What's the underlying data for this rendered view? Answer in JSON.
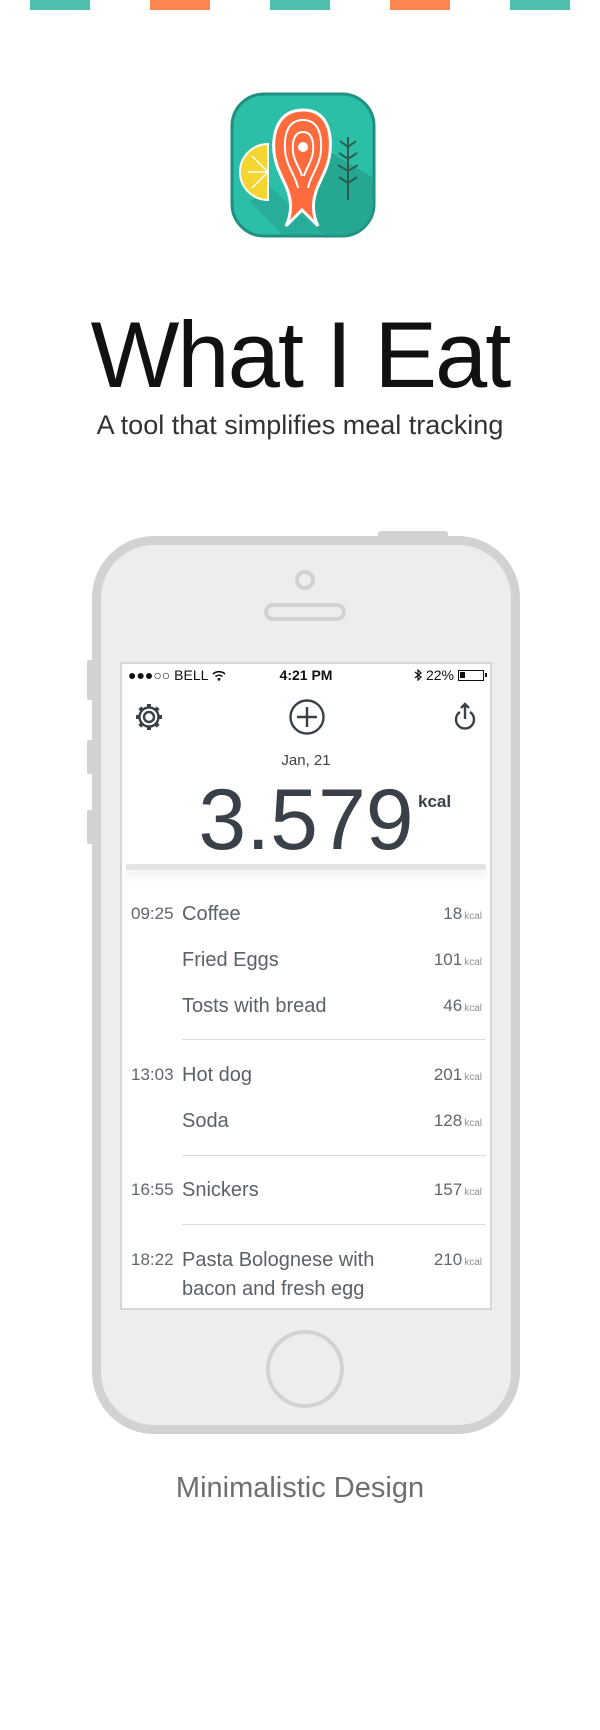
{
  "stripes": [
    {
      "color": "#4dbfad"
    },
    {
      "color": "#ff8551"
    },
    {
      "color": "#4dbfad"
    },
    {
      "color": "#ff8551"
    },
    {
      "color": "#4dbfad"
    }
  ],
  "app": {
    "title": "What I Eat",
    "subtitle": "A tool that simplifies meal tracking",
    "icon_name": "salmon-steak-app-icon",
    "icon_colors": {
      "bg": "#2bbfa8",
      "fish": "#ff6b3d",
      "lemon": "#f5d630",
      "herb": "#2b5e52"
    }
  },
  "statusbar": {
    "carrier": "●●●○○ BELL",
    "time": "4:21 PM",
    "battery": "22%"
  },
  "toolbar": {
    "settings_icon": "gear-icon",
    "add_icon": "plus-circle-icon",
    "share_icon": "power-share-icon"
  },
  "day": {
    "date": "Jan, 21",
    "total": "3.579",
    "unit": "kcal"
  },
  "entries": [
    {
      "time": "09:25",
      "name": "Coffee",
      "kcal": "18",
      "unit": "kcal"
    },
    {
      "time": "",
      "name": "Fried Eggs",
      "kcal": "101",
      "unit": "kcal"
    },
    {
      "time": "",
      "name": "Tosts with bread",
      "kcal": "46",
      "unit": "kcal"
    },
    {
      "time": "13:03",
      "name": "Hot dog",
      "kcal": "201",
      "unit": "kcal"
    },
    {
      "time": "",
      "name": "Soda",
      "kcal": "128",
      "unit": "kcal"
    },
    {
      "time": "16:55",
      "name": "Snickers",
      "kcal": "157",
      "unit": "kcal"
    },
    {
      "time": "18:22",
      "name": "Pasta Bolognese with",
      "name2": "bacon and fresh egg",
      "kcal": "210",
      "unit": "kcal"
    }
  ],
  "caption": "Minimalistic Design"
}
